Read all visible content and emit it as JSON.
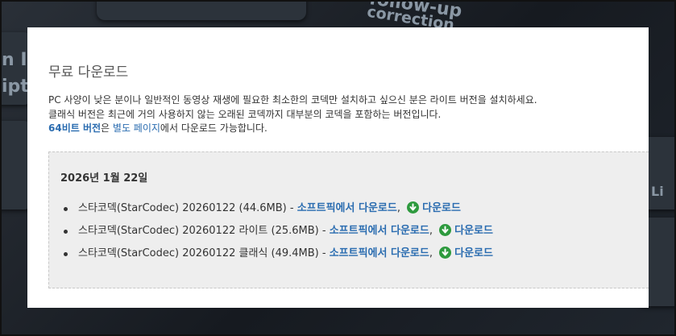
{
  "background": {
    "text_top": "correction",
    "text_top2": "follow-up"
  },
  "page": {
    "title": "무료 다운로드",
    "desc_line1": "PC 사양이 낮은 분이나 일반적인 동영상 재생에 필요한 최소한의 코덱만 설치하고 싶으신 분은 라이트 버전을 설치하세요.",
    "desc_line2": "클래식 버전은 최근에 거의 사용하지 않는 오래된 코덱까지 대부분의 코덱을 포함하는 버전입니다.",
    "desc_line3_link1": "64비트 버전",
    "desc_line3_mid": "은 ",
    "desc_line3_link2": "별도 페이지",
    "desc_line3_tail": "에서 다운로드 가능합니다."
  },
  "release": {
    "date": "2026년 1월 22일",
    "items": [
      {
        "name": "스타코덱(StarCodec) 20260122 (44.6MB)",
        "sep": " - ",
        "mirror_label": "소프트픽에서 다운로드",
        "comma": ",",
        "download_label": "다운로드"
      },
      {
        "name": "스타코덱(StarCodec) 20260122 라이트 (25.6MB)",
        "sep": " - ",
        "mirror_label": "소프트픽에서 다운로드",
        "comma": ",",
        "download_label": "다운로드"
      },
      {
        "name": "스타코덱(StarCodec) 20260122 클래식 (49.4MB)",
        "sep": " - ",
        "mirror_label": "소프트픽에서 다운로드",
        "comma": ",",
        "download_label": "다운로드"
      }
    ]
  },
  "colors": {
    "link": "#2a6cb0",
    "download_icon": "#2e9a3e"
  }
}
